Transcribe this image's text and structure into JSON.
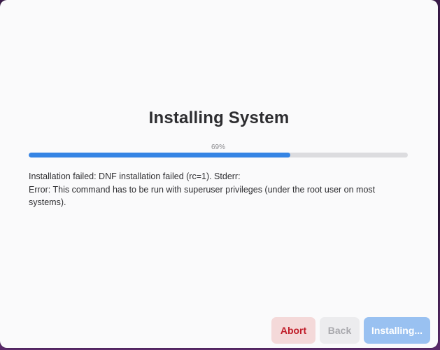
{
  "page": {
    "title": "Installing System"
  },
  "progress": {
    "percent_label": "69%",
    "fraction": 0.69,
    "color": "#3584e4"
  },
  "error": {
    "lines": [
      "Installation failed: DNF installation failed (rc=1). Stderr:",
      "Error: This command has to be run with superuser privileges (under the root user on most",
      "systems)."
    ]
  },
  "buttons": {
    "abort_label": "Abort",
    "back_label": "Back",
    "install_label": "Installing..."
  },
  "colors": {
    "destructive": "#c01c28",
    "accent": "#3584e4"
  }
}
